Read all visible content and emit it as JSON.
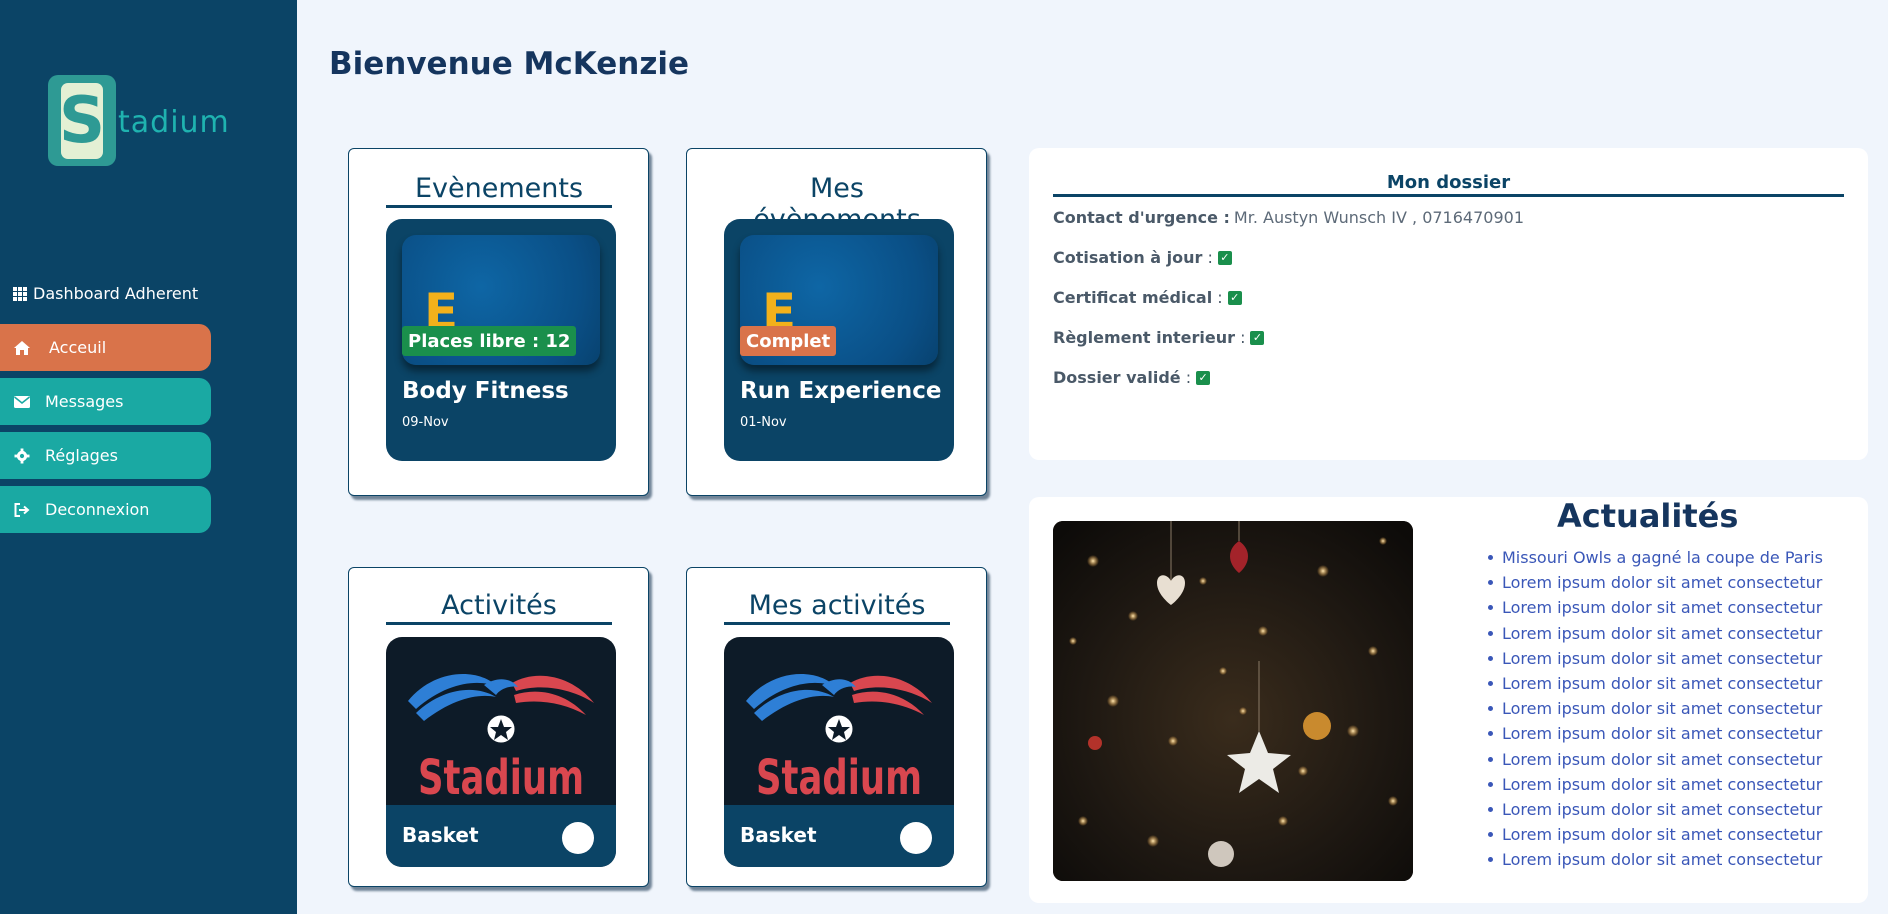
{
  "sidebar": {
    "logo": {
      "letter": "S",
      "text": "tadium"
    },
    "dashboard_title": "Dashboard Adherent",
    "items": [
      {
        "label": "Acceuil",
        "icon": "home-icon",
        "active": true
      },
      {
        "label": "Messages",
        "icon": "envelope-icon",
        "active": false
      },
      {
        "label": "Réglages",
        "icon": "gear-icon",
        "active": false
      },
      {
        "label": "Deconnexion",
        "icon": "sign-out-icon",
        "active": false
      }
    ]
  },
  "header": {
    "welcome": "Bienvenue McKenzie"
  },
  "events": {
    "title": "Evènements",
    "card": {
      "letter": "E",
      "badge": "Places libre : 12",
      "name": "Body Fitness",
      "date": "09-Nov"
    }
  },
  "my_events": {
    "title": "Mes évènements",
    "card": {
      "letter": "E",
      "badge": "Complet",
      "name": "Run Experience",
      "date": "01-Nov"
    }
  },
  "activities": {
    "title": "Activités",
    "card": {
      "logo_text": "Stadium",
      "name": "Basket"
    }
  },
  "my_activities": {
    "title": "Mes activités",
    "card": {
      "logo_text": "Stadium",
      "name": "Basket"
    }
  },
  "dossier": {
    "title": "Mon dossier",
    "emergency_label": "Contact d'urgence :",
    "emergency_value": "Mr. Austyn Wunsch IV , 0716470901",
    "rows": [
      {
        "label": "Cotisation à jour",
        "checked": true
      },
      {
        "label": "Certificat médical",
        "checked": true
      },
      {
        "label": "Règlement interieur",
        "checked": true
      },
      {
        "label": "Dossier validé",
        "checked": true
      }
    ]
  },
  "news": {
    "title": "Actualités",
    "items": [
      "Missouri Owls a gagné la coupe de Paris",
      "Lorem ipsum dolor sit amet consectetur",
      "Lorem ipsum dolor sit amet consectetur",
      "Lorem ipsum dolor sit amet consectetur",
      "Lorem ipsum dolor sit amet consectetur",
      "Lorem ipsum dolor sit amet consectetur",
      "Lorem ipsum dolor sit amet consectetur",
      "Lorem ipsum dolor sit amet consectetur",
      "Lorem ipsum dolor sit amet consectetur",
      "Lorem ipsum dolor sit amet consectetur",
      "Lorem ipsum dolor sit amet consectetur",
      "Lorem ipsum dolor sit amet consectetur",
      "Lorem ipsum dolor sit amet consectetur"
    ]
  },
  "colors": {
    "sidebar": "#0b4466",
    "accent_teal": "#1aa9a3",
    "accent_orange": "#d9734a",
    "success": "#1a8f4c",
    "link": "#3a57b8"
  }
}
